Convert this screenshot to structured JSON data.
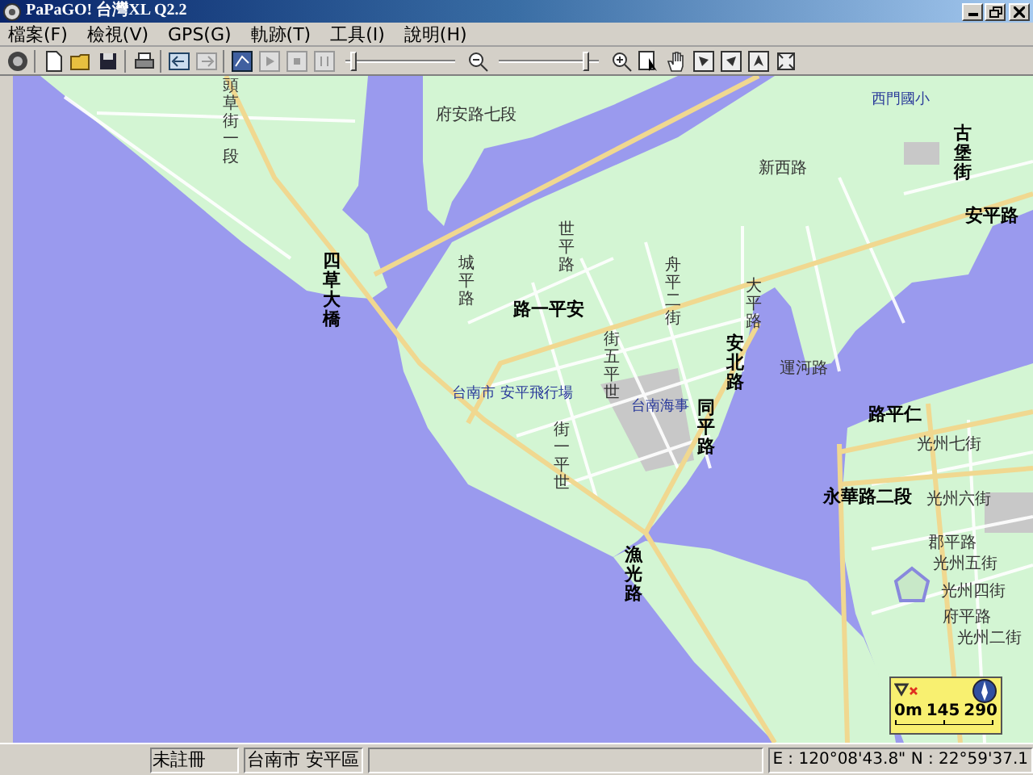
{
  "window": {
    "title": "PaPaGO! 台灣XL Q2.2"
  },
  "menu": [
    "檔案(F)",
    "檢視(V)",
    "GPS(G)",
    "軌跡(T)",
    "工具(I)",
    "說明(H)"
  ],
  "toolbar": {
    "sliders": [
      {
        "level": 0.05
      },
      {
        "level": 0.9
      }
    ]
  },
  "map": {
    "labels": [
      {
        "text": "頭草街一段",
        "kind": "road",
        "vertical": true
      },
      {
        "text": "府安路七段",
        "kind": "road",
        "vertical": false
      },
      {
        "text": "四草大橋",
        "kind": "major",
        "vertical": true
      },
      {
        "text": "西門國小",
        "kind": "place",
        "vertical": false
      },
      {
        "text": "古堡街",
        "kind": "major",
        "vertical": true
      },
      {
        "text": "新西路",
        "kind": "road",
        "vertical": false
      },
      {
        "text": "安平路",
        "kind": "major",
        "vertical": false
      },
      {
        "text": "世平路",
        "kind": "road",
        "vertical": true
      },
      {
        "text": "城平路",
        "kind": "road",
        "vertical": true
      },
      {
        "text": "路一平安",
        "kind": "major",
        "vertical": false
      },
      {
        "text": "舟平二街",
        "kind": "road",
        "vertical": true
      },
      {
        "text": "大平路",
        "kind": "road",
        "vertical": true
      },
      {
        "text": "安北路",
        "kind": "major",
        "vertical": true
      },
      {
        "text": "台南市 安平飛行場",
        "kind": "place",
        "vertical": false
      },
      {
        "text": "街五平世",
        "kind": "road",
        "vertical": true
      },
      {
        "text": "台南海事",
        "kind": "place",
        "vertical": false
      },
      {
        "text": "運河路",
        "kind": "road",
        "vertical": false
      },
      {
        "text": "同平路",
        "kind": "major",
        "vertical": true
      },
      {
        "text": "街一平世",
        "kind": "road",
        "vertical": true
      },
      {
        "text": "路平仁",
        "kind": "major",
        "vertical": false
      },
      {
        "text": "光州七街",
        "kind": "road",
        "vertical": false
      },
      {
        "text": "永華路二段",
        "kind": "major",
        "vertical": false
      },
      {
        "text": "光州六街",
        "kind": "road",
        "vertical": false
      },
      {
        "text": "郡平路",
        "kind": "road",
        "vertical": false
      },
      {
        "text": "光州五街",
        "kind": "road",
        "vertical": false
      },
      {
        "text": "光州四街",
        "kind": "road",
        "vertical": false
      },
      {
        "text": "府平路",
        "kind": "road",
        "vertical": false
      },
      {
        "text": "光州二街",
        "kind": "road",
        "vertical": false
      },
      {
        "text": "漁光路",
        "kind": "major",
        "vertical": true
      }
    ],
    "scale": [
      "0m",
      "145",
      "290"
    ]
  },
  "status_bar": [
    "未註冊",
    "台南市 安平區",
    "E : 120°08'43.8\"   N : 22°59'37.1"
  ]
}
